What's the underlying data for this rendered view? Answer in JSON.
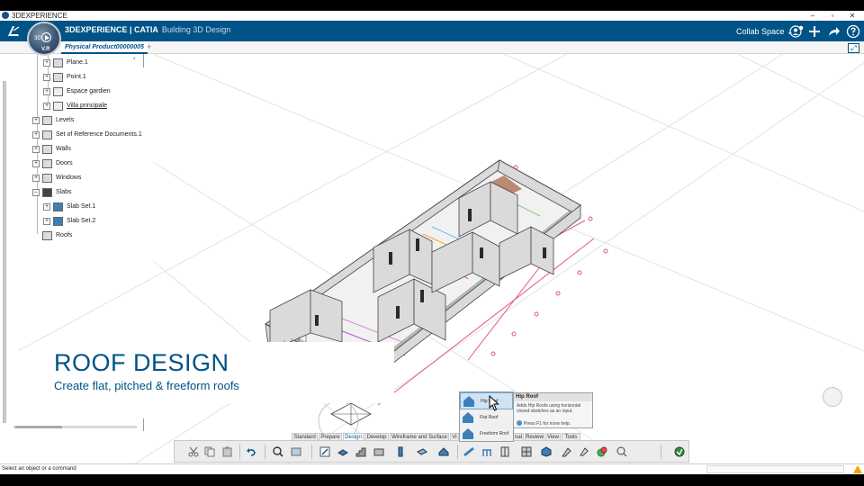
{
  "window": {
    "title": "3DEXPERIENCE",
    "controls": [
      "–",
      "▫",
      "✕"
    ]
  },
  "header": {
    "brand": "3DEXPERIENCE | CATIA",
    "app": "Building 3D Design",
    "collab_space": "Collab Space ⌄",
    "compass": {
      "label_3d": "3D",
      "label_vr": "V.R"
    }
  },
  "tab": {
    "active": "Physical Product00000005",
    "add": "+"
  },
  "tree": {
    "items": [
      {
        "label": "Plane.1",
        "underline": false
      },
      {
        "label": "Point.1",
        "underline": false
      },
      {
        "label": "Espace gardien",
        "underline": false
      },
      {
        "label": "Villa principale",
        "underline": true
      },
      {
        "label": "Levels",
        "underline": false
      },
      {
        "label": "Set of Reference Documents.1",
        "underline": false
      },
      {
        "label": "Walls",
        "underline": false
      },
      {
        "label": "Doors",
        "underline": false
      },
      {
        "label": "Windows",
        "underline": false
      },
      {
        "label": "Slabs",
        "underline": false
      },
      {
        "label": "Slab Set.1",
        "underline": false
      },
      {
        "label": "Slab Set.2",
        "underline": false
      },
      {
        "label": "Roofs",
        "underline": false
      }
    ]
  },
  "banner": {
    "title": "ROOF DESIGN",
    "subtitle": "Create flat, pitched & freeform roofs"
  },
  "roof_menu": {
    "items": [
      "Hip Roof",
      "Flat Roof",
      "Freeform Roof"
    ],
    "selected": "Hip Roof"
  },
  "tooltip": {
    "title": "Hip Roof",
    "body": "Adds Hip Roofs using horizontal closed sketches as an input.",
    "help": "Press F1 for more help."
  },
  "section_tabs": [
    "Standard",
    "Prepare",
    "Design",
    "Develop",
    "Wireframe and Surface",
    "Vi",
    "nal",
    "Review",
    "View",
    "Tools"
  ],
  "active_section": "Design",
  "toolbar": {
    "tools": [
      "cut-icon",
      "copy-icon",
      "paste-icon",
      "undo-icon",
      "zoom-icon",
      "options-icon",
      "sketch-icon",
      "slab-icon",
      "stair-icon",
      "wall-icon",
      "column-icon",
      "opening-icon",
      "door-icon",
      "roof-icon",
      "beam-icon",
      "railing-icon",
      "window-icon",
      "space-icon",
      "curtain-wall-icon",
      "component-icon",
      "tag-icon",
      "annotation-icon",
      "material-icon",
      "measure-icon",
      "publish-icon"
    ]
  },
  "status": {
    "text": "Select an object or a command"
  },
  "colors": {
    "brand": "#005386",
    "accent": "#3d7fb8"
  }
}
